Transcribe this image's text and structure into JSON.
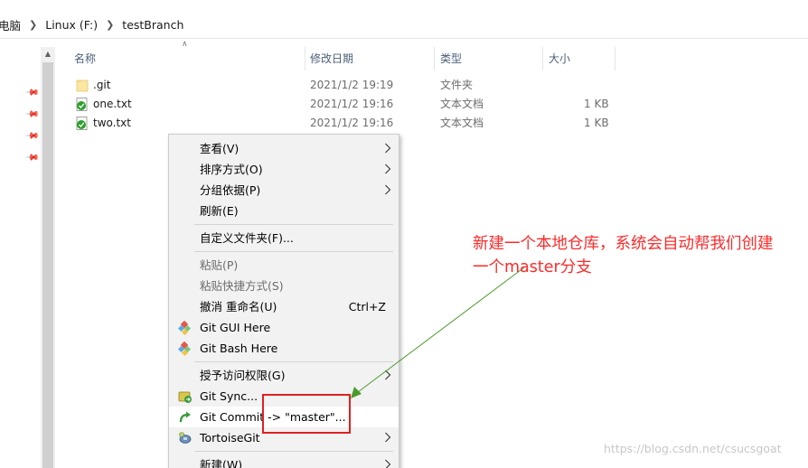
{
  "breadcrumb": {
    "items": [
      "电脑",
      "Linux (F:)",
      "testBranch"
    ]
  },
  "columns": {
    "name": "名称",
    "modified": "修改日期",
    "type": "类型",
    "size": "大小"
  },
  "files": [
    {
      "name": ".git",
      "modified": "2021/1/2 19:19",
      "type": "文件夹",
      "size": "",
      "icon": "folder-icon"
    },
    {
      "name": "one.txt",
      "modified": "2021/1/2 19:16",
      "type": "文本文档",
      "size": "1 KB",
      "icon": "git-file-icon"
    },
    {
      "name": "two.txt",
      "modified": "2021/1/2 19:16",
      "type": "文本文档",
      "size": "1 KB",
      "icon": "git-file-icon"
    }
  ],
  "context_menu": {
    "view": "查看(V)",
    "sort": "排序方式(O)",
    "group": "分组依据(P)",
    "refresh": "刷新(E)",
    "customize": "自定义文件夹(F)...",
    "paste": "粘贴(P)",
    "paste_shortcut": "粘贴快捷方式(S)",
    "undo": "撤消 重命名(U)",
    "undo_shortcut": "Ctrl+Z",
    "git_gui": "Git GUI Here",
    "git_bash": "Git Bash Here",
    "grant_access": "授予访问权限(G)",
    "git_sync": "Git Sync...",
    "git_commit": "Git Commit -> \"master\"...",
    "tortoisegit": "TortoiseGit",
    "new": "新建(W)"
  },
  "annotation": {
    "line1": "新建一个本地仓库，系统会自动帮我们创建",
    "line2": "一个master分支",
    "color": "#ff2a2a"
  },
  "watermark": "https://blog.csdn.net/csucsgoat"
}
